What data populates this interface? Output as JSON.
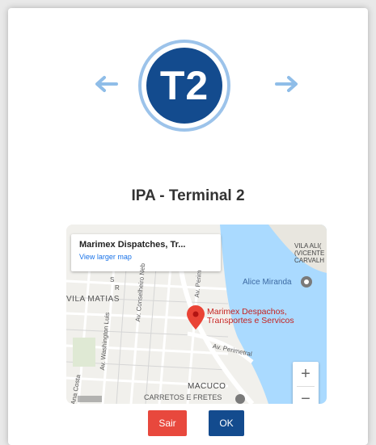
{
  "terminal": {
    "badge_text": "T2",
    "name": "IPA - Terminal 2"
  },
  "map": {
    "info_title": "Marimex Dispatches, Tr...",
    "info_link": "View larger map",
    "place_name_line1": "Marimex Despachos,",
    "place_name_line2": "Transportes e Servicos",
    "area_vila_matias": "VILA MATIAS",
    "area_vila_alic_1": "VILA ALI(",
    "area_vila_alic_2": "(VICENTE",
    "area_vila_alic_3": "CARVALH",
    "alice_miranda": "Alice Miranda",
    "macuco": "MACUCO",
    "carretos": "CARRETOS E FRETES",
    "road_conselheiro": "Av. Conselheiro Neb",
    "road_washington": "Av. Washington Luis",
    "road_perimetral": "Av. Perimetral",
    "road_perim_v": "Av. Perim",
    "road_ana_costa": "Ana Costa",
    "road_s": "S",
    "road_r": "R",
    "zoom_in": "+",
    "zoom_out": "−"
  },
  "buttons": {
    "sair": "Sair",
    "ok": "OK"
  },
  "colors": {
    "badge": "#134b8e",
    "badge_ring": "#9cc3ea",
    "arrow": "#8fbde8",
    "sair": "#e8483d",
    "ok": "#134b8e",
    "water": "#aadaff",
    "pin": "#ea4335"
  }
}
